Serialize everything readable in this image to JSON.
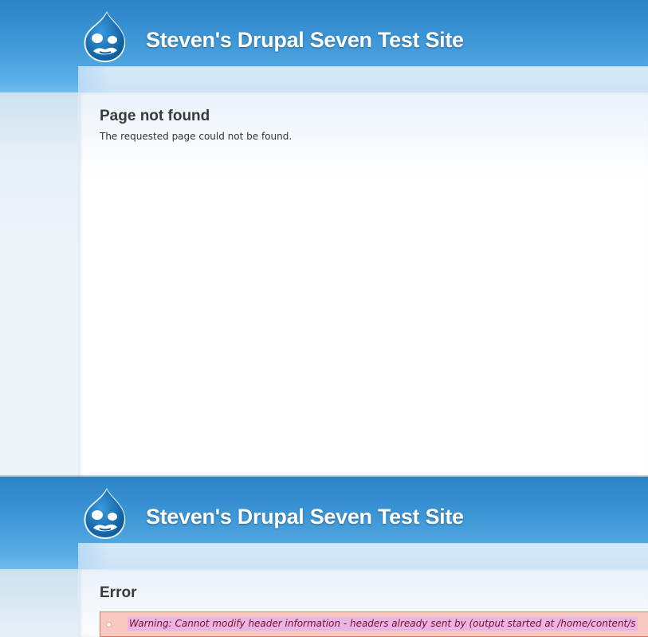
{
  "screens": [
    {
      "site_name": "Steven's Drupal Seven Test Site",
      "page_title": "Page not found",
      "body_text": "The requested page could not be found."
    },
    {
      "site_name": "Steven's Drupal Seven Test Site",
      "page_title": "Error",
      "error_message": "Warning: Cannot modify header information - headers already sent by (output started at /home/content/s"
    }
  ],
  "colors": {
    "header_blue": "#2a83c6",
    "logo_blue": "#1b6fb5",
    "error_bg": "#f9c9c1",
    "error_highlight": "#e9b4e6",
    "error_text": "#7a1020"
  },
  "icons": {
    "logo": "drupal-drop-icon",
    "bullet": "list-bullet-icon"
  }
}
